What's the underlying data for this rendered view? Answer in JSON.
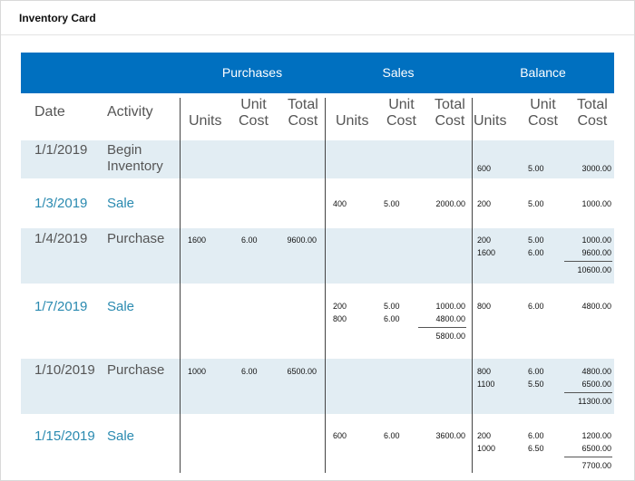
{
  "window": {
    "title": "Inventory Card"
  },
  "table": {
    "groups": [
      "Purchases",
      "Sales",
      "Balance"
    ],
    "headers": {
      "date": "Date",
      "activity": "Activity",
      "units": "Units",
      "unit_cost_1": "Unit",
      "unit_cost_2": "Cost",
      "total_cost_1": "Total",
      "total_cost_2": "Cost"
    },
    "rows": [
      {
        "date": "1/1/2019",
        "activity_1": "Begin",
        "activity_2": "Inventory",
        "type": "begin",
        "purchases": [],
        "sales": [],
        "sales_total": "",
        "balance": [
          {
            "units": "600",
            "unit_cost": "5.00",
            "total": "3000.00"
          }
        ],
        "balance_total": ""
      },
      {
        "date": "1/3/2019",
        "activity_1": "Sale",
        "activity_2": "",
        "type": "sale",
        "purchases": [],
        "sales": [
          {
            "units": "400",
            "unit_cost": "5.00",
            "total": "2000.00"
          }
        ],
        "sales_total": "",
        "balance": [
          {
            "units": "200",
            "unit_cost": "5.00",
            "total": "1000.00"
          }
        ],
        "balance_total": ""
      },
      {
        "date": "1/4/2019",
        "activity_1": "Purchase",
        "activity_2": "",
        "type": "purchase",
        "purchases": [
          {
            "units": "1600",
            "unit_cost": "6.00",
            "total": "9600.00"
          }
        ],
        "sales": [],
        "sales_total": "",
        "balance": [
          {
            "units": "200",
            "unit_cost": "5.00",
            "total": "1000.00"
          },
          {
            "units": "1600",
            "unit_cost": "6.00",
            "total": "9600.00"
          }
        ],
        "balance_total": "10600.00"
      },
      {
        "date": "1/7/2019",
        "activity_1": "Sale",
        "activity_2": "",
        "type": "sale",
        "purchases": [],
        "sales": [
          {
            "units": "200",
            "unit_cost": "5.00",
            "total": "1000.00"
          },
          {
            "units": "800",
            "unit_cost": "6.00",
            "total": "4800.00"
          }
        ],
        "sales_total": "5800.00",
        "balance": [
          {
            "units": "800",
            "unit_cost": "6.00",
            "total": "4800.00"
          }
        ],
        "balance_total": ""
      },
      {
        "date": "1/10/2019",
        "activity_1": "Purchase",
        "activity_2": "",
        "type": "purchase",
        "purchases": [
          {
            "units": "1000",
            "unit_cost": "6.00",
            "total": "6500.00"
          }
        ],
        "sales": [],
        "sales_total": "",
        "balance": [
          {
            "units": "800",
            "unit_cost": "6.00",
            "total": "4800.00"
          },
          {
            "units": "1100",
            "unit_cost": "5.50",
            "total": "6500.00"
          }
        ],
        "balance_total": "11300.00"
      },
      {
        "date": "1/15/2019",
        "activity_1": "Sale",
        "activity_2": "",
        "type": "sale",
        "purchases": [],
        "sales": [
          {
            "units": "600",
            "unit_cost": "6.00",
            "total": "3600.00"
          }
        ],
        "sales_total": "",
        "balance": [
          {
            "units": "200",
            "unit_cost": "6.00",
            "total": "1200.00"
          },
          {
            "units": "1000",
            "unit_cost": "6.50",
            "total": "6500.00"
          }
        ],
        "balance_total": "7700.00"
      }
    ]
  },
  "colors": {
    "header_blue": "#0070c0",
    "row_shade": "#e2edf3",
    "sale_text": "#2a8ab0",
    "default_text": "#555555"
  }
}
